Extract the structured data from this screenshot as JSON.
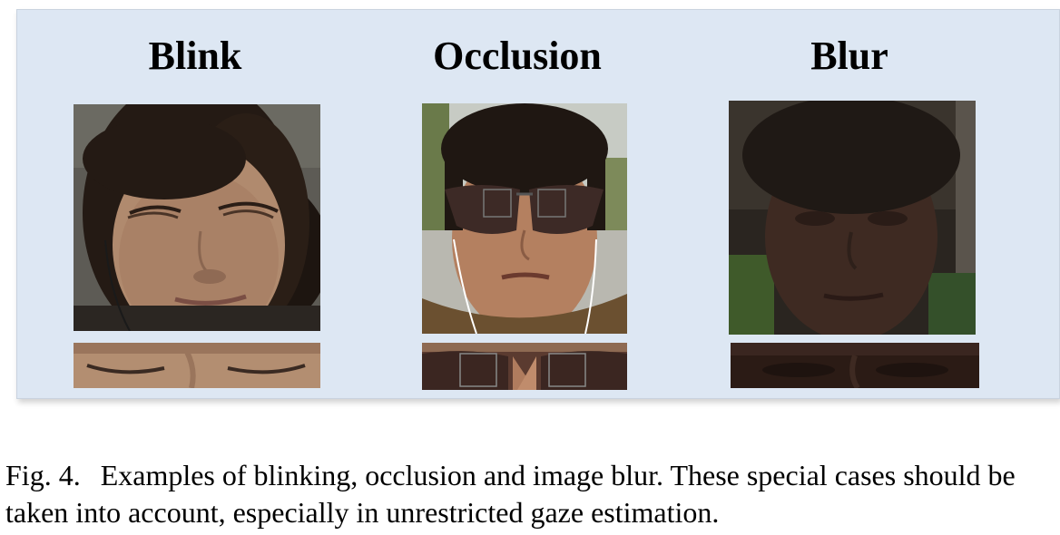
{
  "figure": {
    "columns": [
      {
        "title": "Blink",
        "face_desc": "woman-eyes-closed"
      },
      {
        "title": "Occlusion",
        "face_desc": "man-sunglasses"
      },
      {
        "title": "Blur",
        "face_desc": "dark-blurred-face"
      }
    ],
    "caption_label": "Fig. 4.",
    "caption_text": "Examples of blinking, occlusion and image blur. These special cases should be taken into account, especially in unrestricted gaze estimation."
  }
}
